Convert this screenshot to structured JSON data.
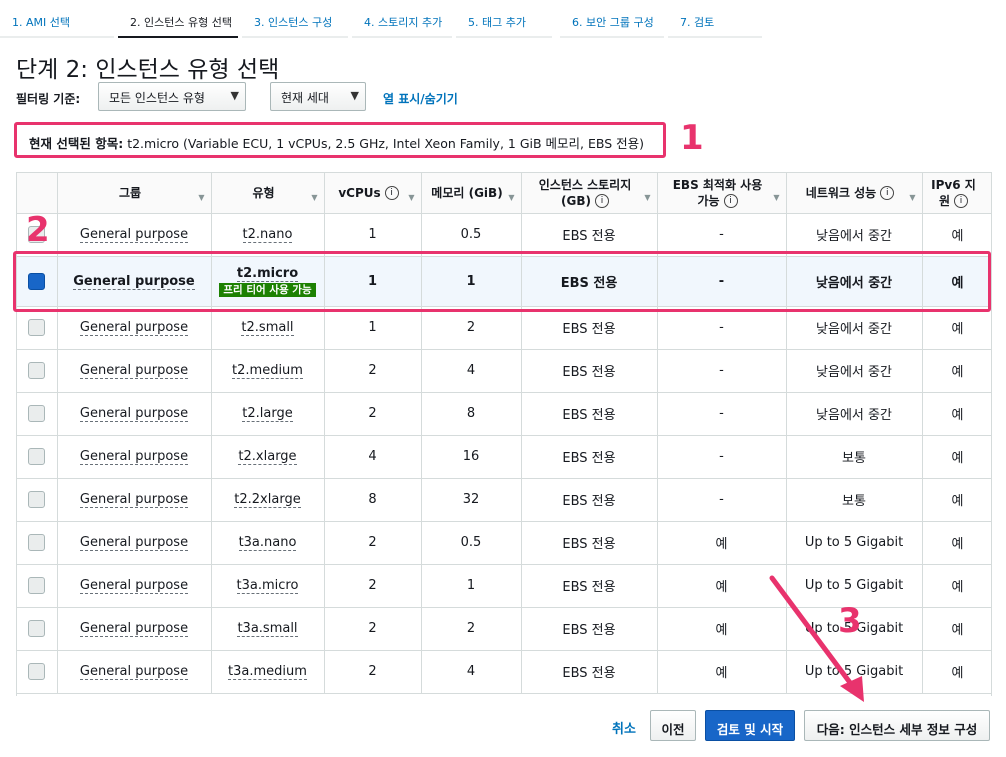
{
  "wizard_steps": [
    {
      "label": "1. AMI 선택",
      "active": false
    },
    {
      "label": "2. 인스턴스 유형 선택",
      "active": true
    },
    {
      "label": "3. 인스턴스 구성",
      "active": false
    },
    {
      "label": "4. 스토리지 추가",
      "active": false
    },
    {
      "label": "5. 태그 추가",
      "active": false
    },
    {
      "label": "6. 보안 그룹 구성",
      "active": false
    },
    {
      "label": "7. 검토",
      "active": false
    }
  ],
  "page_title": "단계 2: 인스턴스 유형 선택",
  "filter": {
    "label": "필터링 기준:",
    "type_select": "모든 인스턴스 유형",
    "generation_select": "현재 세대",
    "columns_link": "열 표시/숨기기"
  },
  "selected_summary": {
    "label": "현재 선택된 항목:",
    "value": "t2.micro (Variable ECU, 1 vCPUs, 2.5 GHz, Intel Xeon Family, 1 GiB 메모리, EBS 전용)"
  },
  "annotations": {
    "n1": "1",
    "n2": "2",
    "n3": "3"
  },
  "table": {
    "headers": [
      "그룹",
      "유형",
      "vCPUs",
      "메모리 (GiB)",
      "인스턴스 스토리지",
      "(GB)",
      "EBS 최적화 사용",
      "가능",
      "네트워크 성능",
      "IPv6 지",
      "원"
    ],
    "info_glyph": "i",
    "free_tier_badge": "프리 티어 사용 가능",
    "rows": [
      {
        "group": "General purpose",
        "type": "t2.nano",
        "vcpus": "1",
        "memory": "0.5",
        "storage": "EBS 전용",
        "ebs": "-",
        "network": "낮음에서 중간",
        "ipv6": "예",
        "checked": false
      },
      {
        "group": "General purpose",
        "type": "t2.micro",
        "vcpus": "1",
        "memory": "1",
        "storage": "EBS 전용",
        "ebs": "-",
        "network": "낮음에서 중간",
        "ipv6": "예",
        "checked": true
      },
      {
        "group": "General purpose",
        "type": "t2.small",
        "vcpus": "1",
        "memory": "2",
        "storage": "EBS 전용",
        "ebs": "-",
        "network": "낮음에서 중간",
        "ipv6": "예",
        "checked": false
      },
      {
        "group": "General purpose",
        "type": "t2.medium",
        "vcpus": "2",
        "memory": "4",
        "storage": "EBS 전용",
        "ebs": "-",
        "network": "낮음에서 중간",
        "ipv6": "예",
        "checked": false
      },
      {
        "group": "General purpose",
        "type": "t2.large",
        "vcpus": "2",
        "memory": "8",
        "storage": "EBS 전용",
        "ebs": "-",
        "network": "낮음에서 중간",
        "ipv6": "예",
        "checked": false
      },
      {
        "group": "General purpose",
        "type": "t2.xlarge",
        "vcpus": "4",
        "memory": "16",
        "storage": "EBS 전용",
        "ebs": "-",
        "network": "보통",
        "ipv6": "예",
        "checked": false
      },
      {
        "group": "General purpose",
        "type": "t2.2xlarge",
        "vcpus": "8",
        "memory": "32",
        "storage": "EBS 전용",
        "ebs": "-",
        "network": "보통",
        "ipv6": "예",
        "checked": false
      },
      {
        "group": "General purpose",
        "type": "t3a.nano",
        "vcpus": "2",
        "memory": "0.5",
        "storage": "EBS 전용",
        "ebs": "예",
        "network": "Up to 5 Gigabit",
        "ipv6": "예",
        "checked": false
      },
      {
        "group": "General purpose",
        "type": "t3a.micro",
        "vcpus": "2",
        "memory": "1",
        "storage": "EBS 전용",
        "ebs": "예",
        "network": "Up to 5 Gigabit",
        "ipv6": "예",
        "checked": false
      },
      {
        "group": "General purpose",
        "type": "t3a.small",
        "vcpus": "2",
        "memory": "2",
        "storage": "EBS 전용",
        "ebs": "예",
        "network": "Up to 5 Gigabit",
        "ipv6": "예",
        "checked": false
      },
      {
        "group": "General purpose",
        "type": "t3a.medium",
        "vcpus": "2",
        "memory": "4",
        "storage": "EBS 전용",
        "ebs": "예",
        "network": "Up to 5 Gigabit",
        "ipv6": "예",
        "checked": false
      }
    ]
  },
  "footer": {
    "cancel": "취소",
    "prev": "이전",
    "review_launch": "검토 및 시작",
    "next": "다음: 인스턴스 세부 정보 구성"
  },
  "colors": {
    "accent": "#1866c8",
    "link": "#0073bb",
    "annotation": "#e8336d",
    "free_tier": "#1d8102"
  }
}
